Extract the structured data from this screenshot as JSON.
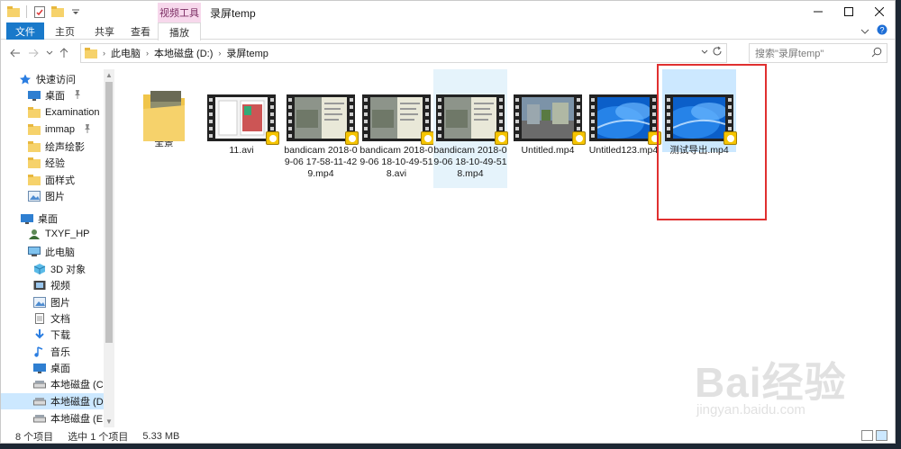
{
  "window": {
    "title": "录屏temp",
    "context_tab_group": "视频工具"
  },
  "ribbon": {
    "tabs": [
      "文件",
      "主页",
      "共享",
      "查看",
      "播放"
    ]
  },
  "address": {
    "crumbs": [
      "此电脑",
      "本地磁盘 (D:)",
      "录屏temp"
    ]
  },
  "search": {
    "placeholder": "搜索\"录屏temp\""
  },
  "sidebar": {
    "items": [
      {
        "label": "快速访问",
        "icon": "star-icon"
      },
      {
        "label": "桌面",
        "icon": "desktop-icon",
        "pinned": true
      },
      {
        "label": "Examination",
        "icon": "folder-icon",
        "pinned": true
      },
      {
        "label": "immap",
        "icon": "folder-icon",
        "pinned": true
      },
      {
        "label": "绘声绘影",
        "icon": "folder-icon"
      },
      {
        "label": "经验",
        "icon": "folder-icon"
      },
      {
        "label": "面样式",
        "icon": "folder-icon"
      },
      {
        "label": "图片",
        "icon": "pictures-icon"
      },
      {
        "label": "桌面",
        "icon": "desktop-icon"
      },
      {
        "label": "TXYF_HP",
        "icon": "user-icon"
      },
      {
        "label": "此电脑",
        "icon": "computer-icon"
      },
      {
        "label": "3D 对象",
        "icon": "3d-objects-icon"
      },
      {
        "label": "视频",
        "icon": "videos-icon"
      },
      {
        "label": "图片",
        "icon": "pictures-icon"
      },
      {
        "label": "文档",
        "icon": "documents-icon"
      },
      {
        "label": "下载",
        "icon": "downloads-icon"
      },
      {
        "label": "音乐",
        "icon": "music-icon"
      },
      {
        "label": "桌面",
        "icon": "desktop-icon"
      },
      {
        "label": "本地磁盘 (C:)",
        "icon": "drive-icon"
      },
      {
        "label": "本地磁盘 (D:)",
        "icon": "drive-icon",
        "selected": true
      },
      {
        "label": "本地磁盘 (E:)",
        "icon": "drive-icon"
      }
    ]
  },
  "files": [
    {
      "name": "全景",
      "type": "folder"
    },
    {
      "name": "11.avi",
      "type": "video",
      "thumb": "doc"
    },
    {
      "name": "bandicam 2018-09-06 17-58-11-429.mp4",
      "type": "video",
      "thumb": "map"
    },
    {
      "name": "bandicam 2018-09-06 18-10-49-518.avi",
      "type": "video",
      "thumb": "map"
    },
    {
      "name": "bandicam 2018-09-06 18-10-49-518.mp4",
      "type": "video",
      "thumb": "map",
      "hover": true
    },
    {
      "name": "Untitled.mp4",
      "type": "video",
      "thumb": "street"
    },
    {
      "name": "Untitled123.mp4",
      "type": "video",
      "thumb": "blue"
    },
    {
      "name": "测试导出.mp4",
      "type": "video",
      "thumb": "blue",
      "selected": true
    }
  ],
  "status": {
    "item_count": "8 个项目",
    "selection": "选中 1 个项目",
    "size": "5.33 MB"
  },
  "watermark": {
    "brand": "Bai经验",
    "url": "jingyan.baidu.com"
  },
  "colors": {
    "accent": "#1979ca",
    "selection": "#cce8ff",
    "highlight_box": "#e03030",
    "context_tab": "#f7d8ec"
  }
}
